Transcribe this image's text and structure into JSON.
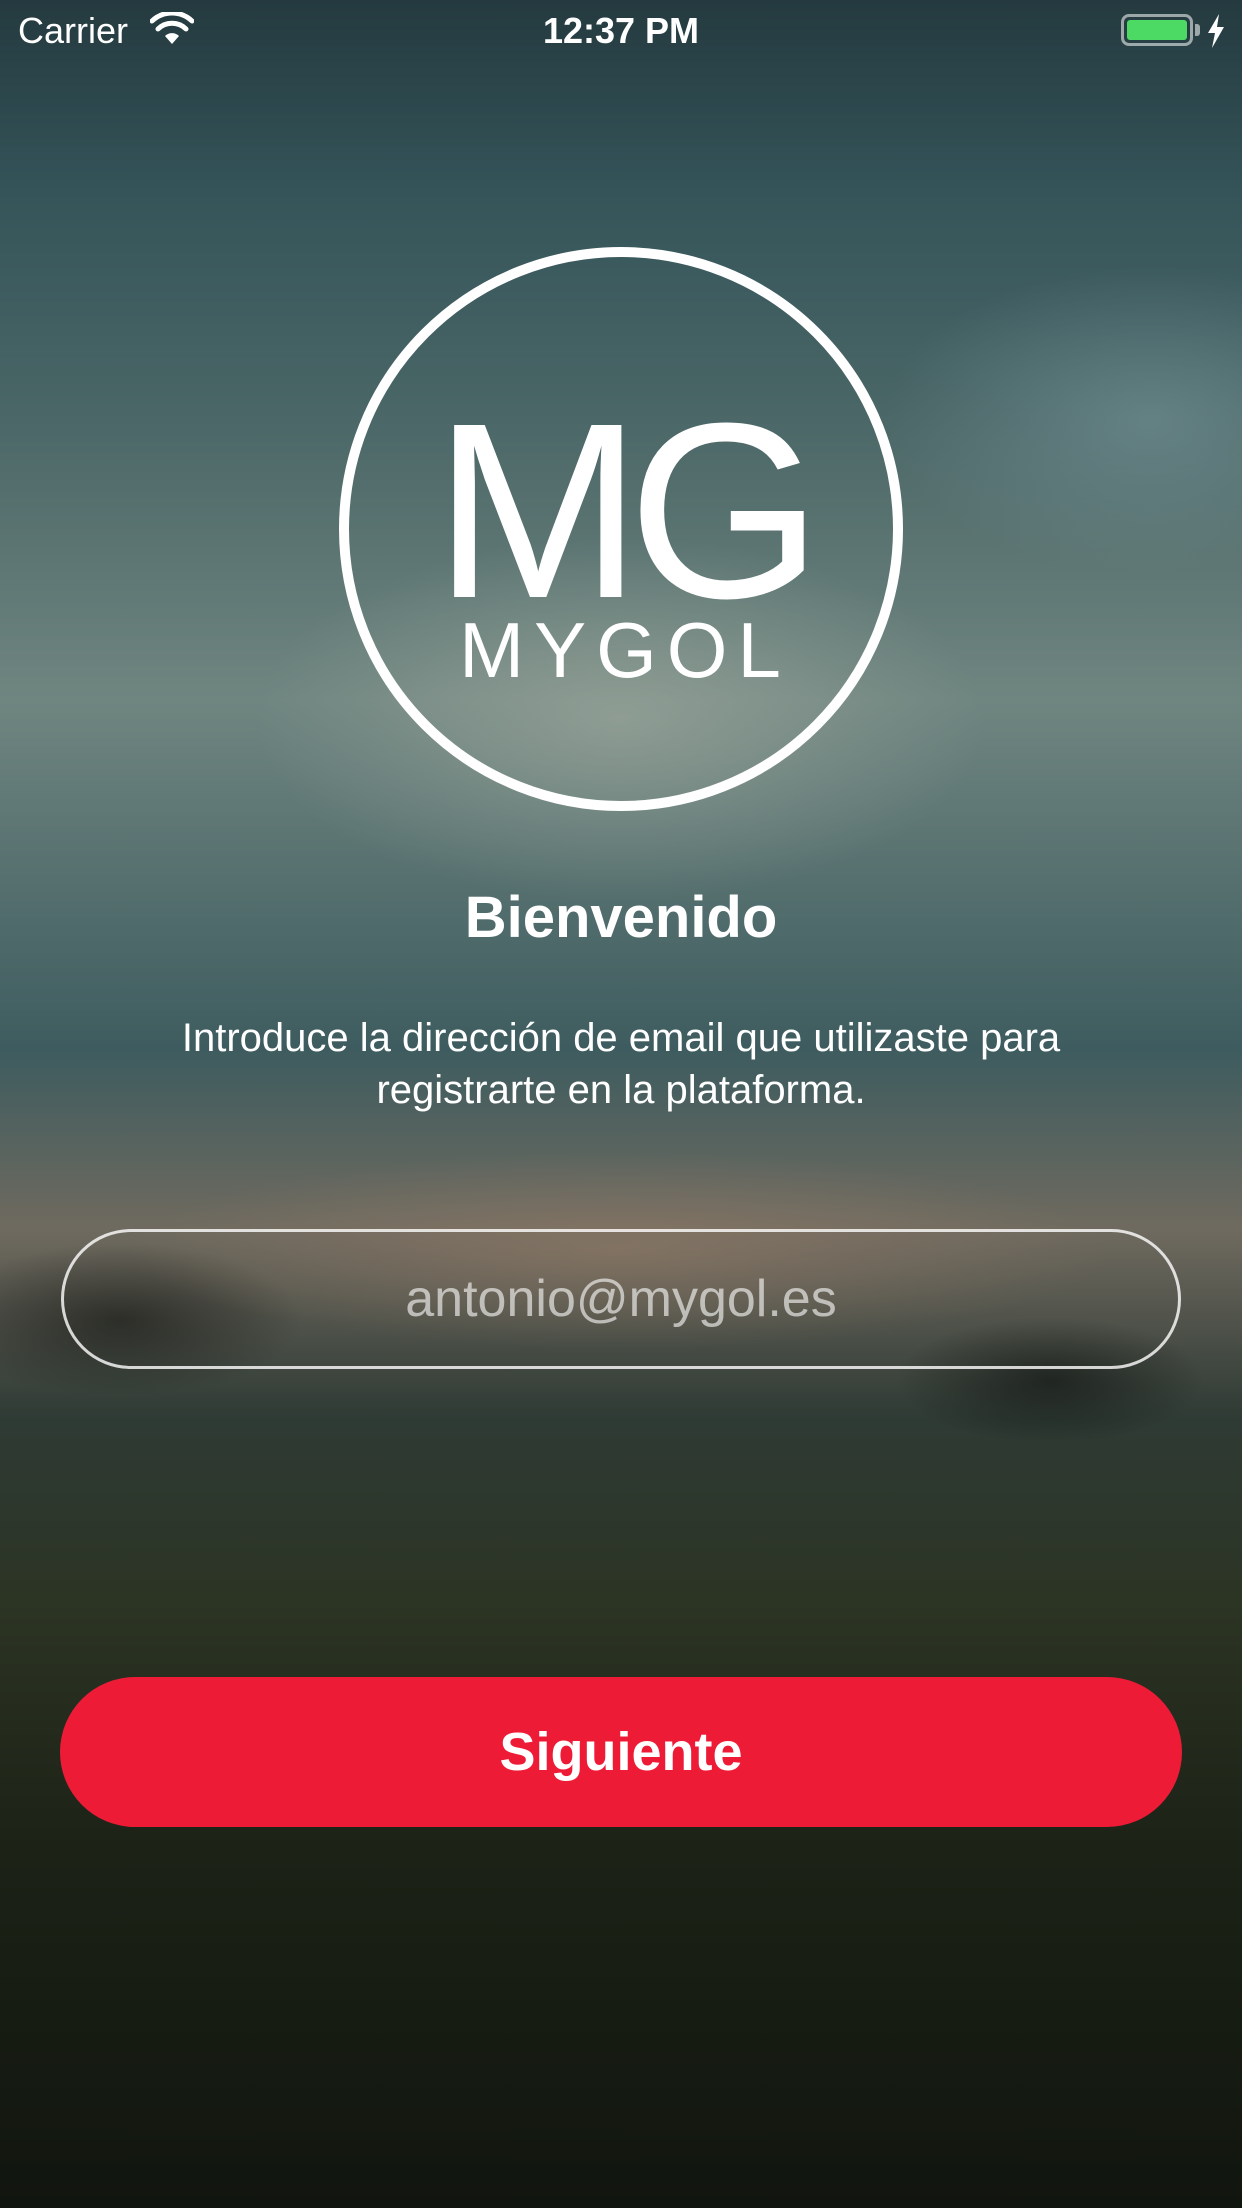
{
  "status_bar": {
    "carrier": "Carrier",
    "time": "12:37 PM",
    "battery_level": 1.0,
    "battery_color": "#4cd964",
    "icons": [
      "wifi-icon",
      "battery-icon",
      "charging-bolt-icon"
    ]
  },
  "logo": {
    "monogram": "MG",
    "wordmark": "MYGOL"
  },
  "welcome": {
    "title": "Bienvenido",
    "subtitle": "Introduce la dirección de email que utilizaste para registrarte en la plataforma."
  },
  "email_input": {
    "placeholder": "antonio@mygol.es",
    "value": ""
  },
  "next_button": {
    "label": "Siguiente",
    "color": "#ee1b37"
  }
}
